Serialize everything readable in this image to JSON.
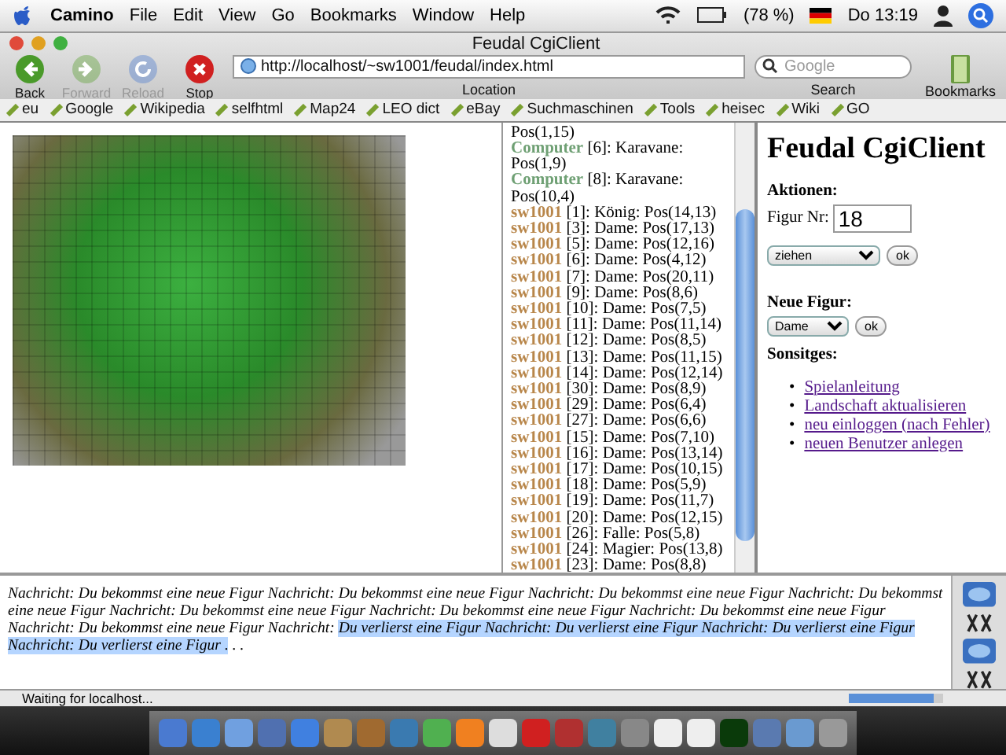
{
  "menubar": {
    "app": "Camino",
    "menus": [
      "File",
      "Edit",
      "View",
      "Go",
      "Bookmarks",
      "Window",
      "Help"
    ],
    "battery": "(78 %)",
    "clock": "Do 13:19"
  },
  "window": {
    "title": "Feudal CgiClient"
  },
  "toolbar": {
    "buttons": [
      {
        "label": "Back",
        "disabled": false,
        "kind": "back"
      },
      {
        "label": "Forward",
        "disabled": true,
        "kind": "forward"
      },
      {
        "label": "Reload",
        "disabled": true,
        "kind": "reload"
      },
      {
        "label": "Stop",
        "disabled": false,
        "kind": "stop"
      }
    ],
    "url": "http://localhost/~sw1001/feudal/index.html",
    "url_label": "Location",
    "search": {
      "placeholder": "Google",
      "label": "Search"
    },
    "bookmarks_label": "Bookmarks"
  },
  "bookmarks_bar": [
    "eu",
    "Google",
    "Wikipedia",
    "selfhtml",
    "Map24",
    "LEO dict",
    "eBay",
    "Suchmaschinen",
    "Tools",
    "heisec",
    "Wiki",
    "GO"
  ],
  "units": [
    {
      "text": "Pos(1,15)"
    },
    {
      "owner": "Computer",
      "color": "#6fa074",
      "text": "[6]: Karavane: Pos(1,9)"
    },
    {
      "owner": "Computer",
      "color": "#6fa074",
      "text": "[8]: Karavane: Pos(10,4)"
    },
    {
      "owner": "sw1001",
      "color": "#b8864a",
      "text": "[1]: König: Pos(14,13)"
    },
    {
      "owner": "sw1001",
      "color": "#b8864a",
      "text": "[3]: Dame: Pos(17,13)"
    },
    {
      "owner": "sw1001",
      "color": "#b8864a",
      "text": "[5]: Dame: Pos(12,16)"
    },
    {
      "owner": "sw1001",
      "color": "#b8864a",
      "text": "[6]: Dame: Pos(4,12)"
    },
    {
      "owner": "sw1001",
      "color": "#b8864a",
      "text": "[7]: Dame: Pos(20,11)"
    },
    {
      "owner": "sw1001",
      "color": "#b8864a",
      "text": "[9]: Dame: Pos(8,6)"
    },
    {
      "owner": "sw1001",
      "color": "#b8864a",
      "text": "[10]: Dame: Pos(7,5)"
    },
    {
      "owner": "sw1001",
      "color": "#b8864a",
      "text": "[11]: Dame: Pos(11,14)"
    },
    {
      "owner": "sw1001",
      "color": "#b8864a",
      "text": "[12]: Dame: Pos(8,5)"
    },
    {
      "owner": "sw1001",
      "color": "#b8864a",
      "text": "[13]: Dame: Pos(11,15)"
    },
    {
      "owner": "sw1001",
      "color": "#b8864a",
      "text": "[14]: Dame: Pos(12,14)"
    },
    {
      "owner": "sw1001",
      "color": "#b8864a",
      "text": "[30]: Dame: Pos(8,9)"
    },
    {
      "owner": "sw1001",
      "color": "#b8864a",
      "text": "[29]: Dame: Pos(6,4)"
    },
    {
      "owner": "sw1001",
      "color": "#b8864a",
      "text": "[27]: Dame: Pos(6,6)"
    },
    {
      "owner": "sw1001",
      "color": "#b8864a",
      "text": "[15]: Dame: Pos(7,10)"
    },
    {
      "owner": "sw1001",
      "color": "#b8864a",
      "text": "[16]: Dame: Pos(13,14)"
    },
    {
      "owner": "sw1001",
      "color": "#b8864a",
      "text": "[17]: Dame: Pos(10,15)"
    },
    {
      "owner": "sw1001",
      "color": "#b8864a",
      "text": "[18]: Dame: Pos(5,9)"
    },
    {
      "owner": "sw1001",
      "color": "#b8864a",
      "text": "[19]: Dame: Pos(11,7)"
    },
    {
      "owner": "sw1001",
      "color": "#b8864a",
      "text": "[20]: Dame: Pos(12,15)"
    },
    {
      "owner": "sw1001",
      "color": "#b8864a",
      "text": "[26]: Falle: Pos(5,8)"
    },
    {
      "owner": "sw1001",
      "color": "#b8864a",
      "text": "[24]: Magier: Pos(13,8)"
    },
    {
      "owner": "sw1001",
      "color": "#b8864a",
      "text": "[23]: Dame: Pos(8,8)"
    }
  ],
  "panel": {
    "heading": "Feudal CgiClient",
    "actions_heading": "Aktionen:",
    "figure_label": "Figur Nr:",
    "figure_value": "18",
    "action_select": "ziehen",
    "action_ok": "ok",
    "new_heading": "Neue Figur:",
    "new_select": "Dame",
    "new_ok": "ok",
    "misc_heading": "Sonsitges:",
    "links": [
      {
        "marker": "•",
        "text": "Spielanleitung"
      },
      {
        "marker": "•",
        "text": "Landschaft aktualisieren"
      },
      {
        "marker": "•",
        "text": "neu einloggen (nach Fehler)"
      },
      {
        "marker": "•",
        "text": "neuen Benutzer anlegen"
      }
    ]
  },
  "messages": [
    {
      "text": "Nachricht: Du bekommst eine neue Figur Nachricht: Du bekommst eine neue Figur Nachricht: Du bekommst eine neue Figur Nachricht: Du bekommst eine neue Figur Nachricht: Du bekommst eine neue Figur Nachricht: Du bekommst eine neue Figur Nachricht: Du bekommst eine neue Figur Nachricht: Du bekommst eine neue Figur Nachricht: ",
      "selected": false
    },
    {
      "text": "Du verlierst eine Figur Nachricht: Du verlierst eine Figur Nachricht: Du verlierst eine Figur Nachricht: Du verlierst eine Figur .",
      "selected": true
    },
    {
      "text": " . .",
      "selected": false
    }
  ],
  "status_bar": {
    "text": "Waiting for localhost...",
    "level": 0.9
  }
}
